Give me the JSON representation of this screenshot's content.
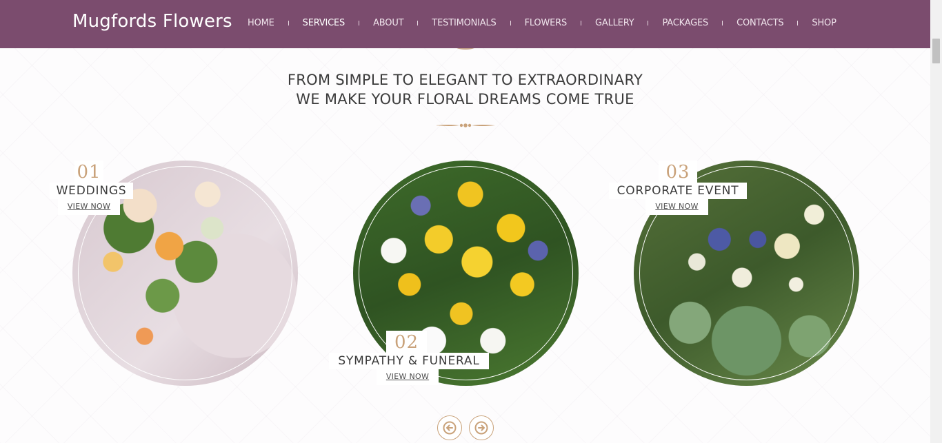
{
  "brand": {
    "name": "Mugfords Flowers"
  },
  "nav": {
    "items": [
      {
        "label": "HOME",
        "active": false
      },
      {
        "label": "SERVICES",
        "active": true
      },
      {
        "label": "ABOUT",
        "active": false
      },
      {
        "label": "TESTIMONIALS",
        "active": false
      },
      {
        "label": "FLOWERS",
        "active": false
      },
      {
        "label": "GALLERY",
        "active": false
      },
      {
        "label": "PACKAGES",
        "active": false
      },
      {
        "label": "CONTACTS",
        "active": false
      },
      {
        "label": "SHOP",
        "active": false
      }
    ]
  },
  "intro": {
    "line1": "FROM SIMPLE TO ELEGANT TO EXTRAORDINARY",
    "line2": "WE MAKE YOUR FLORAL DREAMS COME TRUE"
  },
  "services": [
    {
      "number": "01",
      "title": "WEDDINGS",
      "link": "VIEW NOW",
      "image": "wedding-bouquet-image"
    },
    {
      "number": "02",
      "title": "SYMPATHY & FUNERAL",
      "link": "VIEW NOW",
      "image": "sympathy-bouquet-image"
    },
    {
      "number": "03",
      "title": "CORPORATE EVENT",
      "link": "VIEW NOW",
      "image": "corporate-bouquet-image"
    }
  ],
  "carousel": {
    "prev_icon": "arrow-left-icon",
    "next_icon": "arrow-right-icon"
  },
  "colors": {
    "nav_bg": "#7b4c6e",
    "accent_gold": "#c9a27a",
    "text": "#3b3b3b"
  }
}
